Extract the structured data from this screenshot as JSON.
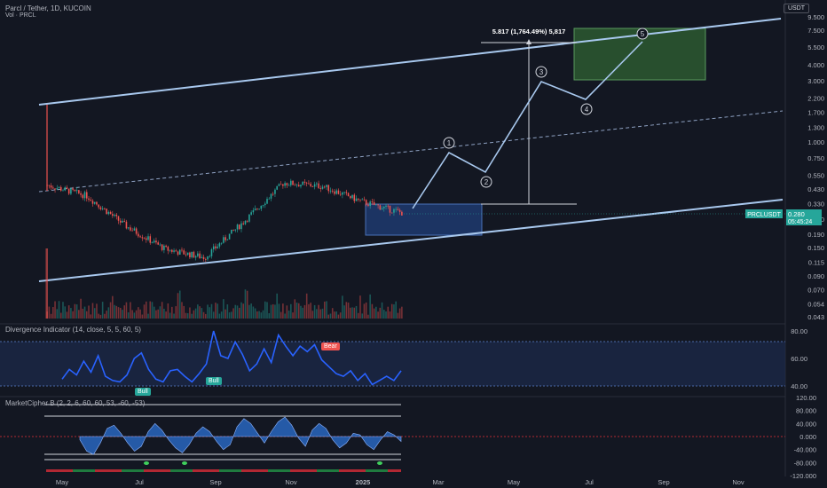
{
  "header": {
    "symbol_line": "Parcl / Tether, 1D, KUCOIN",
    "volume_line": "Vol · PRCL",
    "currency": "USDT"
  },
  "price_badge": {
    "ticker": "PRCLUSDT",
    "price": "0.280",
    "countdown": "05:45:24"
  },
  "indicators": {
    "divergence_title": "Divergence Indicator (14, close, 5, 5, 60, 5)",
    "marketcipher_title": "MarketCipher B (2, 2, 6, 60, 60, 53, -60, -53)",
    "labels": [
      "Bull",
      "Bull",
      "Bear"
    ]
  },
  "measure_label": "5.817 (1,764.49%) 5,817",
  "wave_labels": [
    "1",
    "2",
    "3",
    "4",
    "5"
  ],
  "colors": {
    "background": "#131722",
    "channel": "#a8c8ee",
    "up_candle": "#26a69a",
    "down_candle": "#ef5350",
    "rsi_line": "#2962ff",
    "target_box": "#2e5e32",
    "entry_box": "#1e3a6e"
  },
  "chart_data": [
    {
      "type": "candlestick",
      "y_scale": "log",
      "price_axis_ticks": [
        "9.500",
        "7.500",
        "5.500",
        "4.000",
        "3.000",
        "2.200",
        "1.700",
        "1.300",
        "1.000",
        "0.750",
        "0.550",
        "0.430",
        "0.330",
        "0.250",
        "0.190",
        "0.150",
        "0.115",
        "0.090",
        "0.070",
        "0.054",
        "0.043"
      ],
      "time_axis_ticks": [
        "May",
        "Jul",
        "Sep",
        "Nov",
        "2025",
        "Mar",
        "May",
        "Jul",
        "Sep",
        "Nov"
      ],
      "last_price": 0.28,
      "approx_close_path": [
        {
          "t": "May",
          "price": 0.46
        },
        {
          "t": "Jun",
          "price": 0.38
        },
        {
          "t": "Jul",
          "price": 0.22
        },
        {
          "t": "Aug",
          "price": 0.145
        },
        {
          "t": "Sep",
          "price": 0.125
        },
        {
          "t": "Oct",
          "price": 0.24
        },
        {
          "t": "Nov",
          "price": 0.48
        },
        {
          "t": "Dec",
          "price": 0.45
        },
        {
          "t": "2025",
          "price": 0.34
        },
        {
          "t": "Jan",
          "price": 0.28
        }
      ],
      "elliott_wave_projection": [
        {
          "label": "start",
          "price": 0.28
        },
        {
          "label": "1",
          "price": 0.8
        },
        {
          "label": "2",
          "price": 0.58
        },
        {
          "label": "3",
          "price": 3.2
        },
        {
          "label": "4",
          "price": 2.2
        },
        {
          "label": "5",
          "price": 6.4
        }
      ],
      "measured_move": {
        "from": 0.33,
        "to": 5.817,
        "percent": 1764.49
      }
    },
    {
      "type": "line",
      "name": "Divergence Indicator",
      "y_axis_ticks": [
        "80.00",
        "60.00",
        "40.00"
      ],
      "ylim": [
        30,
        85
      ],
      "values": [
        45,
        52,
        48,
        58,
        50,
        62,
        47,
        44,
        43,
        48,
        60,
        64,
        52,
        45,
        43,
        51,
        52,
        47,
        43,
        49,
        56,
        80,
        62,
        60,
        72,
        63,
        51,
        56,
        67,
        57,
        77,
        69,
        62,
        69,
        65,
        70,
        59,
        54,
        49,
        47,
        51,
        44,
        49,
        41,
        44,
        47,
        44,
        51
      ]
    },
    {
      "type": "area",
      "name": "MarketCipher B",
      "y_axis_ticks": [
        "120.00",
        "80.000",
        "40.000",
        "0.000",
        "-40.000",
        "-80.000",
        "-120.000"
      ],
      "ylim": [
        -120,
        120
      ],
      "values": [
        -10,
        -45,
        -55,
        -20,
        25,
        35,
        10,
        -20,
        -45,
        -30,
        15,
        40,
        20,
        -10,
        -35,
        -50,
        -25,
        10,
        30,
        15,
        -15,
        -40,
        -25,
        30,
        55,
        40,
        10,
        -20,
        15,
        45,
        60,
        35,
        -5,
        -30,
        20,
        40,
        25,
        -10,
        -35,
        -20,
        10,
        5,
        -25,
        -40,
        -10,
        15,
        5,
        -15
      ]
    }
  ]
}
